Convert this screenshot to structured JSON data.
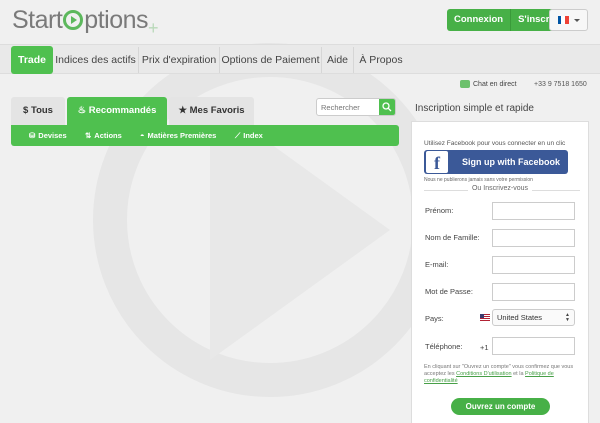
{
  "brand": {
    "name_pre": "Start",
    "name_post": "ptions",
    "plus": "+"
  },
  "header": {
    "login_label": "Connexion",
    "signup_label": "S'inscrire"
  },
  "nav": {
    "items": [
      "Trade",
      "Indices des actifs",
      "Prix d'expiration",
      "Options de Paiement",
      "Aide",
      "À Propos"
    ]
  },
  "contact": {
    "chat_label": "Chat en direct",
    "phone": "+33 9 7518 1650"
  },
  "tabs": [
    {
      "icon": "$",
      "label": "Tous"
    },
    {
      "icon": "♨",
      "label": "Recommandés"
    },
    {
      "icon": "★",
      "label": "Mes Favoris"
    }
  ],
  "search": {
    "placeholder": "Rechercher"
  },
  "subnav": [
    {
      "icon": "⛁",
      "label": "Devises"
    },
    {
      "icon": "⇅",
      "label": "Actions"
    },
    {
      "icon": "◓",
      "label": "Matières Premières"
    },
    {
      "icon": "⟋",
      "label": "Index"
    }
  ],
  "signup": {
    "title": "Inscription simple et rapide",
    "fb_intro": "Utilisez Facebook pour vous connecter en un clic",
    "fb_button": "Sign up with Facebook",
    "fb_note": "Nous ne publierons jamais sans votre permission",
    "or_text": "Ou Inscrivez-vous",
    "fields": {
      "prenom": "Prénom:",
      "nom": "Nom de Famille:",
      "email": "E-mail:",
      "password": "Mot de Passe:",
      "pays": "Pays:",
      "telephone": "Téléphone:"
    },
    "country_value": "United States",
    "phone_prefix": "+1",
    "terms_pre": "En cliquant sur \"Ouvrez un compte\" vous confirmez que vous acceptez les",
    "terms_link1": "Conditions D'utilisation",
    "terms_mid": "et la",
    "terms_link2": "Politique de confidentialité",
    "submit_label": "Ouvrez un compte"
  },
  "colors": {
    "accent": "#4fc04f",
    "facebook": "#3b5998"
  }
}
